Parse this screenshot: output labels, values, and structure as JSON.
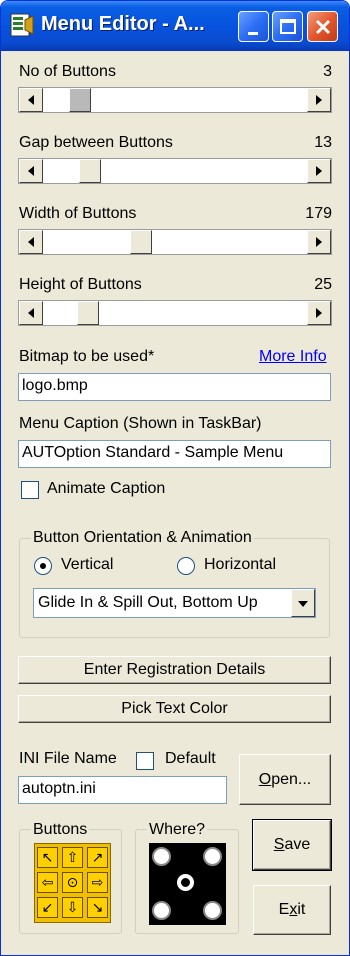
{
  "window": {
    "title": "Menu Editor - A...",
    "controls": [
      "minimize-icon",
      "maximize-icon",
      "close-icon"
    ]
  },
  "sliders": [
    {
      "label": "No of Buttons",
      "value": "3",
      "thumb": "dotted"
    },
    {
      "label": "Gap between Buttons",
      "value": "13"
    },
    {
      "label": "Width of Buttons",
      "value": "179"
    },
    {
      "label": "Height of Buttons",
      "value": "25"
    }
  ],
  "bitmap": {
    "label": "Bitmap to be used*",
    "link": "More Info",
    "value": "logo.bmp"
  },
  "caption": {
    "label": "Menu Caption (Shown in TaskBar)",
    "value": "AUTOption Standard - Sample Menu"
  },
  "animate_caption": {
    "label": "Animate Caption",
    "checked": false
  },
  "orientation": {
    "legend": "Button Orientation & Animation",
    "vertical_label": "Vertical",
    "horizontal_label": "Horizontal",
    "selected": "Vertical",
    "animation_value": "Glide In & Spill Out, Bottom Up"
  },
  "buttons": {
    "registration": "Enter Registration Details",
    "pick_color": "Pick Text Color",
    "open_rest": "pen...",
    "open_accel": "O",
    "save_rest": "ave",
    "save_accel": "S",
    "exit_pre": "E",
    "exit_accel": "x",
    "exit_post": "it"
  },
  "ini": {
    "label": "INI File Name",
    "default_label": "Default",
    "default_checked": false,
    "value": "autoptn.ini"
  },
  "position_pad": {
    "legend": "Buttons",
    "cells": [
      "↖",
      "⇧",
      "↗",
      "⇦",
      "⊙",
      "⇨",
      "↙",
      "⇩",
      "↘"
    ]
  },
  "where": {
    "legend": "Where?"
  },
  "colors": {
    "title_bar": "#0753de",
    "face": "#ece9d8",
    "link": "#0000ff",
    "close_button": "#e3582f",
    "pad": "#ffd000"
  }
}
